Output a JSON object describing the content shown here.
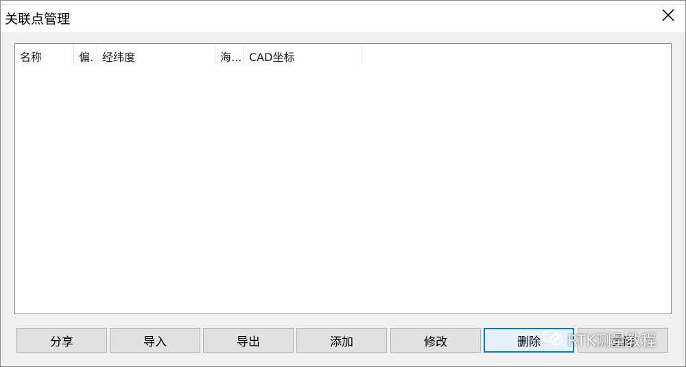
{
  "window": {
    "title": "关联点管理"
  },
  "listview": {
    "columns": [
      "名称",
      "偏.",
      "经纬度",
      "海...",
      "CAD坐标"
    ]
  },
  "buttons": {
    "share": "分享",
    "import": "导入",
    "export": "导出",
    "add": "添加",
    "modify": "修改",
    "delete": "删除",
    "close": "关闭"
  },
  "watermark": {
    "text": "RTK测量教程",
    "icon": "wechat-icon"
  },
  "colors": {
    "focus_border": "#0078d7",
    "button_bg": "#e1e1e1",
    "dialog_bg": "#f0f0f0"
  }
}
